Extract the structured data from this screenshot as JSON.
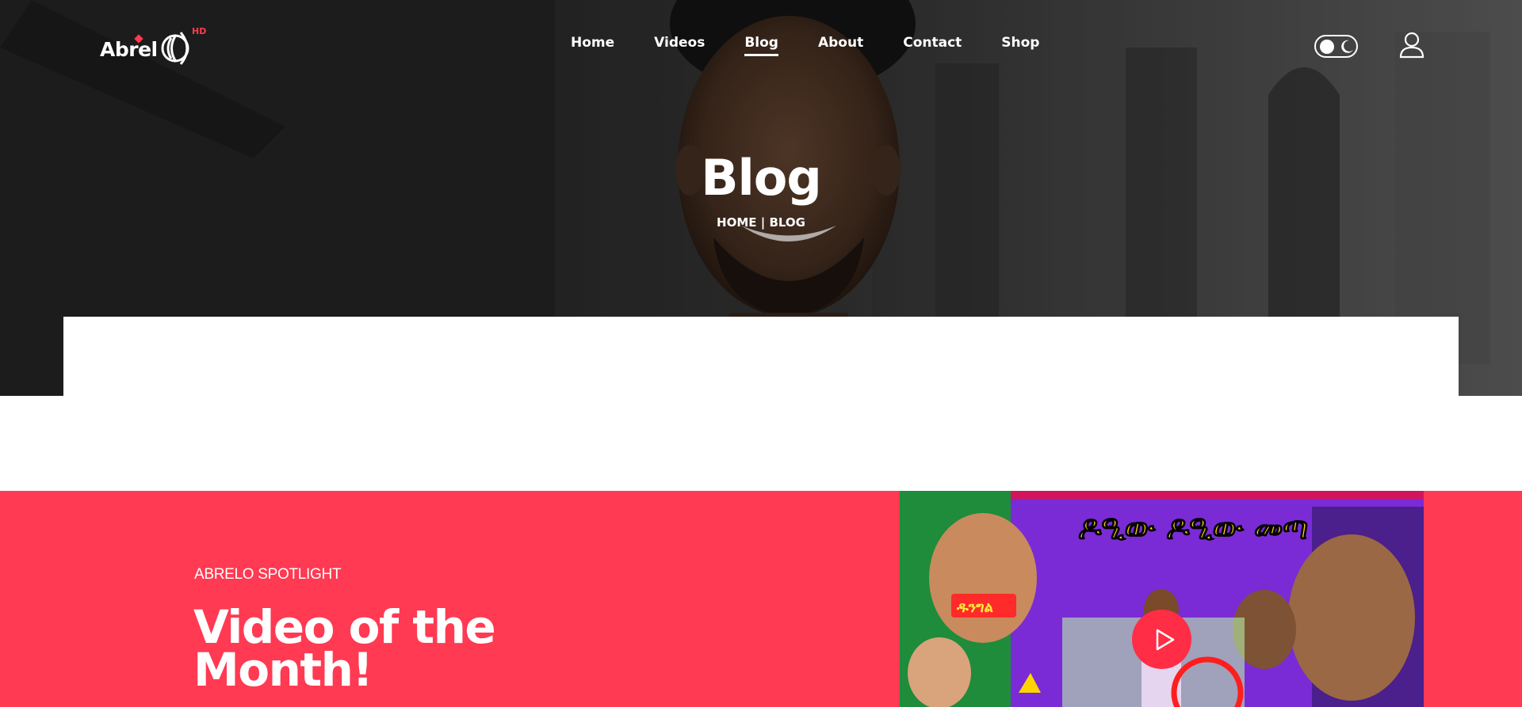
{
  "brand": {
    "logo_text": "Abrel",
    "logo_badge": "HD",
    "accent": "#ff3a52"
  },
  "nav": {
    "items": [
      {
        "label": "Home",
        "active": false
      },
      {
        "label": "Videos",
        "active": false
      },
      {
        "label": "Blog",
        "active": true
      },
      {
        "label": "About",
        "active": false
      },
      {
        "label": "Contact",
        "active": false
      },
      {
        "label": "Shop",
        "active": false
      }
    ]
  },
  "header_icons": {
    "theme_toggle": "theme-toggle-icon",
    "account": "user-icon"
  },
  "hero": {
    "title": "Blog",
    "breadcrumb": {
      "home": "HOME",
      "separator": " | ",
      "current": "BLOG"
    }
  },
  "spotlight": {
    "kicker": "ABRELO SPOTLIGHT",
    "title_line1": "Video of the",
    "title_line2": "Month!",
    "thumbnail_caption": "ዶዒው ዶዒው መጣ",
    "thumbnail_badge": "ዱንግል",
    "play_icon": "play-icon"
  }
}
